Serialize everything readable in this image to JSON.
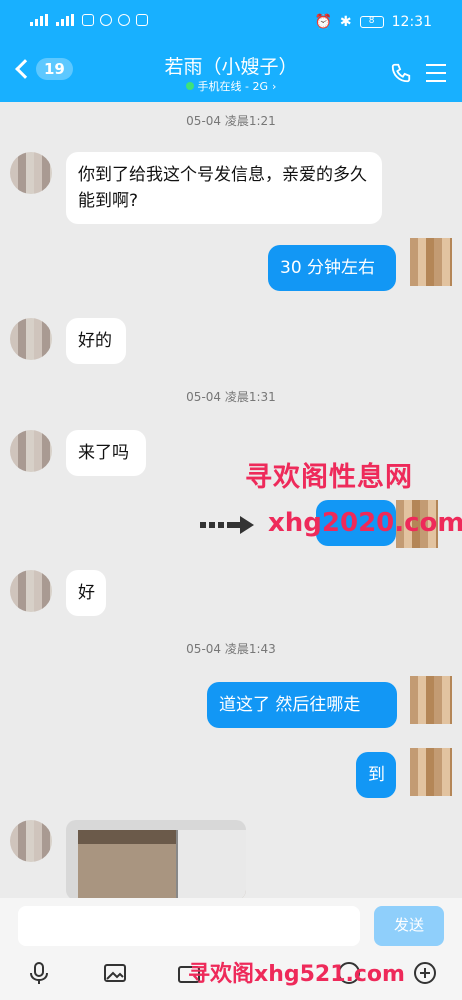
{
  "status": {
    "time": "12:31",
    "battery": "8"
  },
  "header": {
    "unread_count": "19",
    "contact_name": "若雨（小嫂子）",
    "contact_status": "手机在线 - 2G",
    "status_color": "#3ee27a",
    "bar_color": "#18b0ff"
  },
  "messages": {
    "t1": "05-04 凌晨1:21",
    "m1": "你到了给我这个号发信息，亲爱的多久能到啊?",
    "m2": "30 分钟左右",
    "m3": "好的",
    "t2": "05-04 凌晨1:31",
    "m4": "来了吗",
    "m5": "",
    "m6": "好",
    "t3": "05-04 凌晨1:43",
    "m7": "道这了  然后往哪走",
    "m8": "到"
  },
  "watermark": {
    "line1": "寻欢阁性息网",
    "line2": "xhg2020.com",
    "line3": "寻欢阁xhg521.com"
  },
  "input": {
    "placeholder": "",
    "send_label": "发送"
  },
  "colors": {
    "outgoing_bubble": "#1297f5",
    "incoming_bubble": "#ffffff",
    "watermark": "#ee2a5a"
  }
}
